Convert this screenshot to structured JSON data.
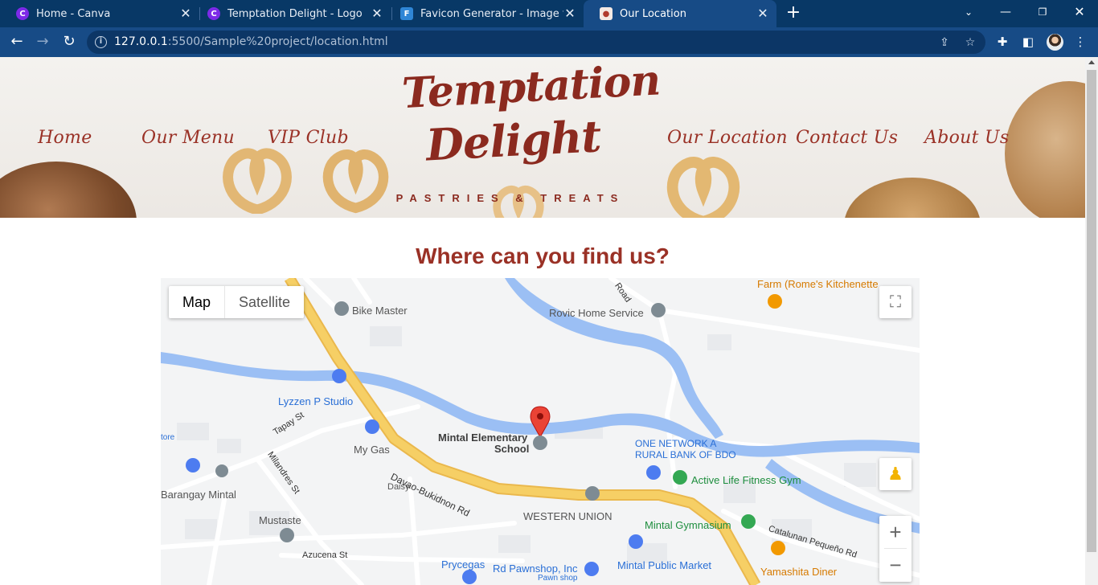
{
  "browser": {
    "tabs": [
      {
        "title": "Home - Canva",
        "favicon": "canva-icon",
        "active": false
      },
      {
        "title": "Temptation Delight - Logo",
        "favicon": "canva-icon",
        "active": false
      },
      {
        "title": "Favicon Generator - Image to Fav",
        "favicon": "favicon-generator-icon",
        "active": false
      },
      {
        "title": "Our Location",
        "favicon": "site-icon",
        "active": true
      }
    ],
    "url_host": "127.0.0.1",
    "url_rest": ":5500/Sample%20project/location.html",
    "colors": {
      "tabbar": "#083866",
      "toolbar": "#174b86",
      "omnibox": "#0c3666"
    }
  },
  "site": {
    "nav_left": [
      "Home",
      "Our Menu",
      "VIP Club"
    ],
    "nav_right": [
      "Our Location",
      "Contact Us",
      "About Us"
    ],
    "logo": {
      "line1": "Temptation",
      "line2": "Delight",
      "tagline": "PASTRIES & TREATS"
    },
    "brand_color": "#9a3126",
    "heading": "Where can you find us?"
  },
  "map": {
    "type_buttons": [
      "Map",
      "Satellite"
    ],
    "selected_type": "Map",
    "places": {
      "school": {
        "line1": "Mintal Elementary",
        "line2": "School"
      },
      "bike_master": "Bike Master",
      "rovic": "Rovic Home Service",
      "farm": "Farm (Rome's Kitchenette",
      "lyzzen": "Lyzzen P Studio",
      "store": "tore",
      "my_gas": "My Gas",
      "one_network": {
        "line1": "ONE NETWORK A",
        "line2": "RURAL BANK OF BDO"
      },
      "active_life": "Active Life Fitness Gym",
      "barangay": "Barangay Mintal",
      "daisy": "Daisy",
      "western_union": "WESTERN UNION",
      "mintal_gym": "Mintal Gymnasium",
      "mustaste": "Mustaste",
      "prycegas": "Prycegas",
      "rd_pawnshop": "Rd Pawnshop, Inc",
      "pawn_shop": "Pawn shop",
      "public_market": "Mintal Public Market",
      "yamashita": "Yamashita Diner"
    },
    "roads": {
      "davao": "Davao-Bukidnon Rd",
      "tapay": "Tapay St",
      "milandres": "Milandres St",
      "azucena": "Azucena St",
      "catalunan": "Catalunan Pequeño Rd",
      "road": "Road"
    },
    "colors": {
      "water": "#9bbff4",
      "main_road": "#f6cf65",
      "land": "#f3f4f5",
      "pin": "#ea4335"
    }
  }
}
